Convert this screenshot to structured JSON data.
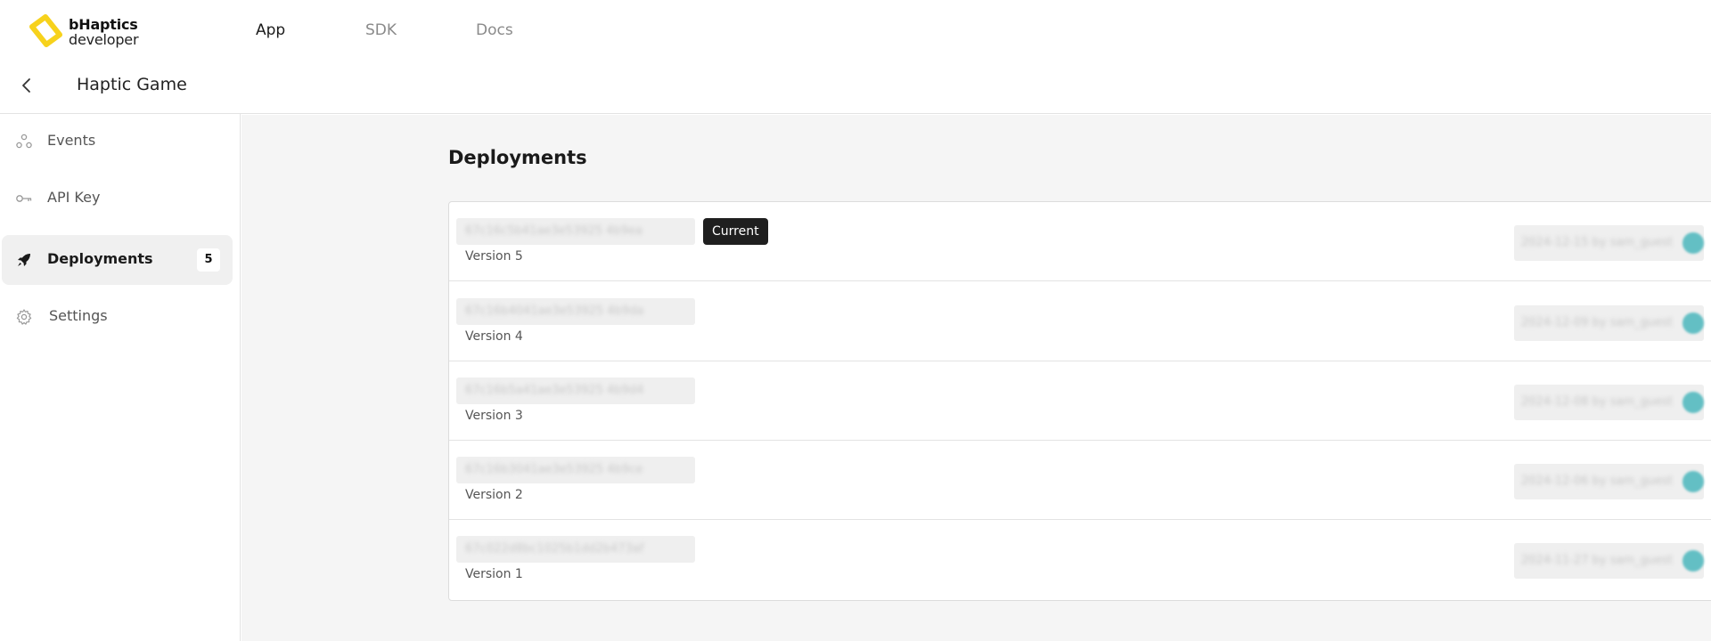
{
  "header": {
    "logo_line1": "bHaptics",
    "logo_line2": "developer",
    "nav": [
      {
        "label": "App",
        "active": true
      },
      {
        "label": "SDK",
        "active": false
      },
      {
        "label": "Docs",
        "active": false
      }
    ]
  },
  "subheader": {
    "back_icon": "chevron-left-icon",
    "title": "Haptic Game"
  },
  "sidebar": {
    "items": [
      {
        "label": "Events",
        "icon": "events-icon",
        "active": false
      },
      {
        "label": "API Key",
        "icon": "key-icon",
        "active": false
      },
      {
        "label": "Deployments",
        "icon": "rocket-icon",
        "active": true,
        "badge": "5"
      },
      {
        "label": "Settings",
        "icon": "gear-icon",
        "active": false
      }
    ]
  },
  "main": {
    "title": "Deployments",
    "current_label": "Current",
    "deployments": [
      {
        "version": "Version 5",
        "hash": "67c16c5b41ae3e53925 4b9ea",
        "meta": "2024-12-15 by sam_guest",
        "current": true
      },
      {
        "version": "Version 4",
        "hash": "67c16b4041ae3e53925 4b9da",
        "meta": "2024-12-09 by sam_guest",
        "current": false
      },
      {
        "version": "Version 3",
        "hash": "67c16b5a41ae3e53925 4b9d4",
        "meta": "2024-12-08 by sam_guest",
        "current": false
      },
      {
        "version": "Version 2",
        "hash": "67c16b3041ae3e53925 4b9ce",
        "meta": "2024-12-06 by sam_guest",
        "current": false
      },
      {
        "version": "Version 1",
        "hash": "67c022d8bc1025b1dd2b473af",
        "meta": "2024-11-27 by sam_guest",
        "current": false
      }
    ]
  },
  "colors": {
    "logo_yellow": "#f7d21c",
    "accent_teal": "#63bfc4",
    "badge_dark": "#1f1f1f"
  }
}
